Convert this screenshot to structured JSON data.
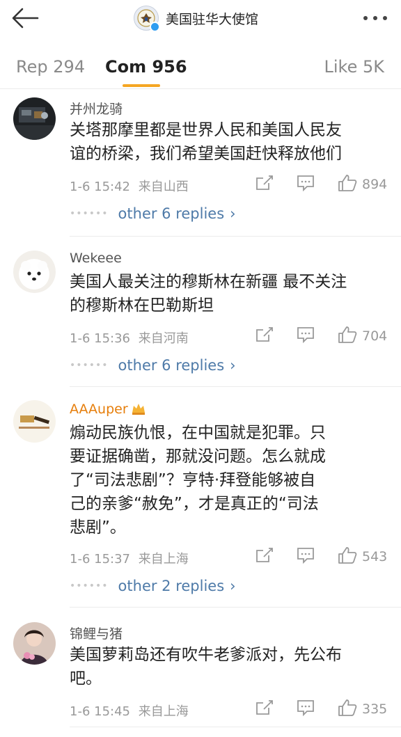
{
  "header": {
    "account_name": "美国驻华大使馆",
    "icons": {
      "back": "back-arrow-icon",
      "more": "more-dots-icon",
      "verified": "verified-badge-icon"
    }
  },
  "tabs": [
    {
      "label": "Rep 294"
    },
    {
      "label": "Com 956"
    },
    {
      "label": "Like 5K"
    }
  ],
  "active_tab": "Com 956",
  "accent_color": "#f5a623",
  "link_color": "#4e7aa8",
  "comments": [
    {
      "username": "并州龙骑",
      "line1": "关塔那摩里都是世界人民和美国人民友",
      "line2": "谊的桥梁，我们希望美国赶快释放他们",
      "time": "1-6 15:42",
      "location": "来自山西",
      "likes": "894",
      "replies": "other 6 replies"
    },
    {
      "username": "Wekeee",
      "line1": "美国人最关注的穆斯林在新疆 最不关注",
      "line2": "的穆斯林在巴勒斯坦",
      "time": "1-6 15:36",
      "location": "来自河南",
      "likes": "704",
      "replies": "other 6 replies"
    },
    {
      "username": "AAAuper",
      "line1": "煽动民族仇恨，在中国就是犯罪。只",
      "line2": "要证据确凿，那就没问题。怎么就成",
      "line3": "了“司法悲剧”？亨特·拜登能够被自",
      "line4": "己的亲爹“赦免”，才是真正的“司法",
      "line5": "悲剧”。",
      "time": "1-6 15:37",
      "location": "来自上海",
      "likes": "543",
      "replies": "other 2 replies"
    },
    {
      "username": "锦鲤与猪",
      "line1": "美国萝莉岛还有吹牛老爹派对，先公布",
      "line2": "吧。",
      "time": "1-6 15:45",
      "location": "来自上海",
      "likes": "335"
    }
  ],
  "action_icons": [
    "share-icon",
    "comment-icon",
    "thumbs-up-icon"
  ]
}
